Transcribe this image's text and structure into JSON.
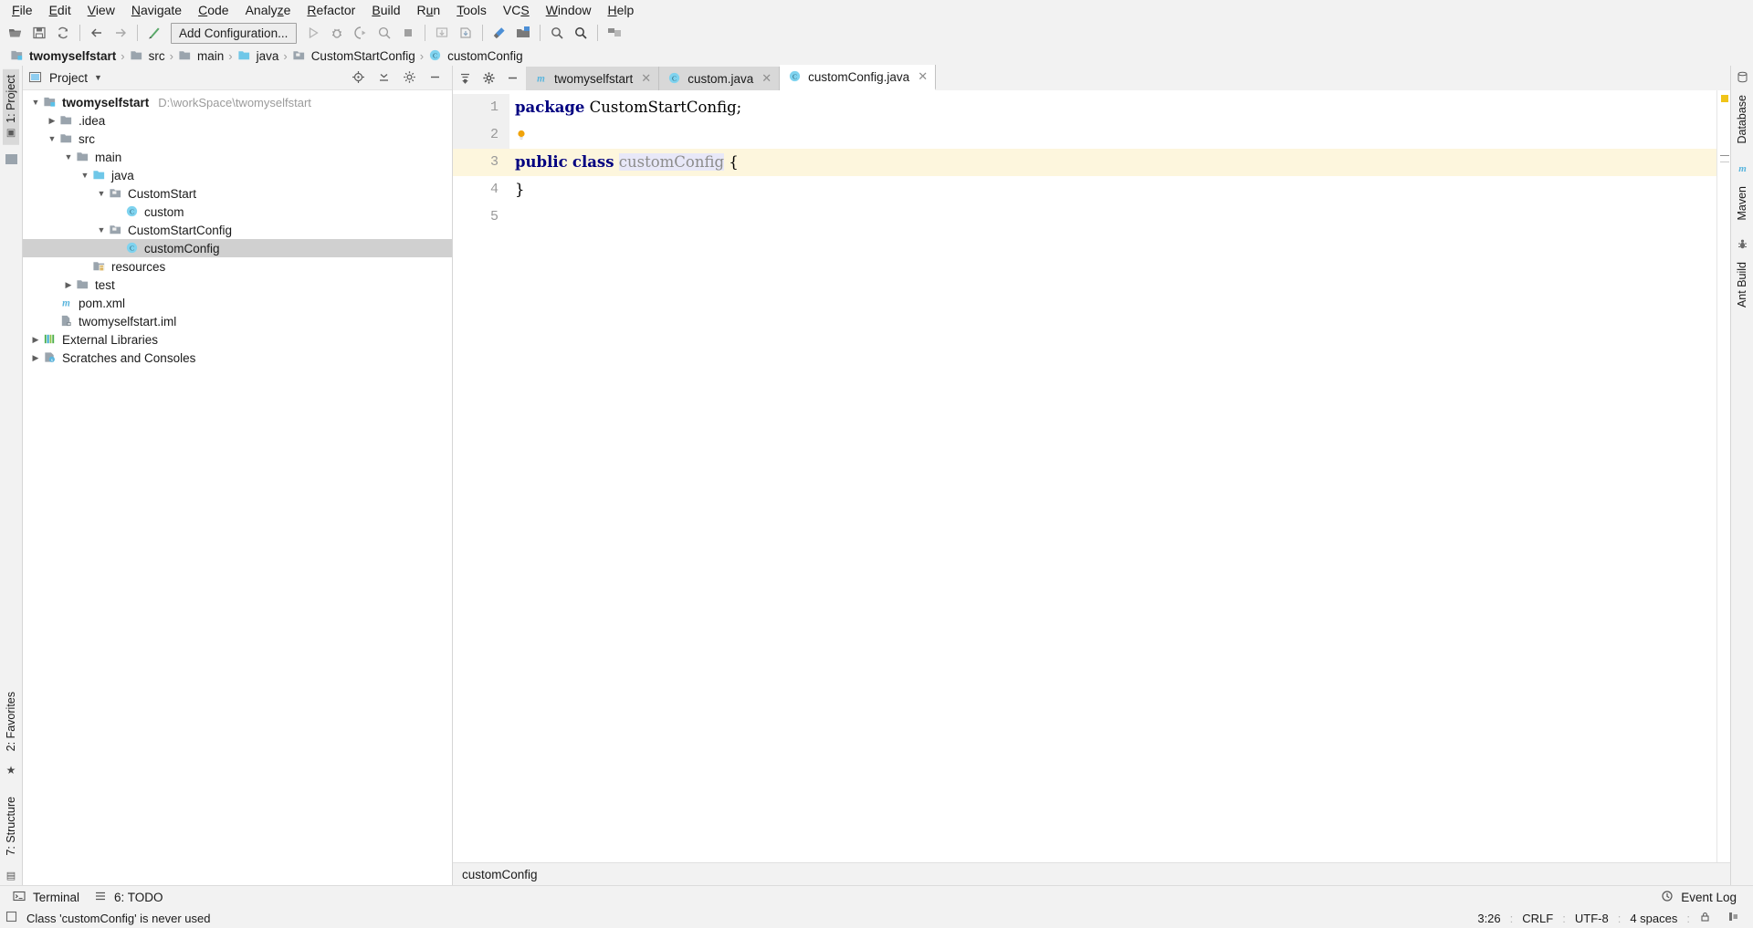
{
  "menubar": {
    "items": [
      {
        "label": "File",
        "accel": "F"
      },
      {
        "label": "Edit",
        "accel": "E"
      },
      {
        "label": "View",
        "accel": "V"
      },
      {
        "label": "Navigate",
        "accel": "N"
      },
      {
        "label": "Code",
        "accel": "C"
      },
      {
        "label": "Analyze",
        "accel": "z"
      },
      {
        "label": "Refactor",
        "accel": "R"
      },
      {
        "label": "Build",
        "accel": "B"
      },
      {
        "label": "Run",
        "accel": "u"
      },
      {
        "label": "Tools",
        "accel": "T"
      },
      {
        "label": "VCS",
        "accel": "S"
      },
      {
        "label": "Window",
        "accel": "W"
      },
      {
        "label": "Help",
        "accel": "H"
      }
    ]
  },
  "toolbar": {
    "run_configuration": "Add Configuration...",
    "buttons": [
      "open-icon",
      "save-all-icon",
      "sync-icon",
      "back-icon",
      "forward-icon",
      "build-icon",
      "run-icon",
      "debug-icon",
      "run-coverage-icon",
      "profile-icon",
      "stop-icon",
      "update-project-icon",
      "commit-icon",
      "settings-icon",
      "project-structure-icon",
      "search-everywhere-icon",
      "search-icon",
      "layout-icon"
    ]
  },
  "breadcrumb": {
    "items": [
      {
        "label": "twomyselfstart",
        "icon": "module-icon",
        "bold": true
      },
      {
        "label": "src",
        "icon": "folder-icon",
        "bold": false
      },
      {
        "label": "main",
        "icon": "folder-icon",
        "bold": false
      },
      {
        "label": "java",
        "icon": "source-root-icon",
        "bold": false
      },
      {
        "label": "CustomStartConfig",
        "icon": "package-icon",
        "bold": false
      },
      {
        "label": "customConfig",
        "icon": "class-icon",
        "bold": false
      }
    ]
  },
  "left_rail": {
    "top": [
      {
        "label": "1: Project",
        "icon": "project-icon",
        "selected": true
      }
    ],
    "bottom": [
      {
        "label": "2: Favorites",
        "icon": "star-icon",
        "selected": false
      },
      {
        "label": "7: Structure",
        "icon": "structure-icon",
        "selected": false
      }
    ]
  },
  "right_rail": {
    "items": [
      "Database",
      "Maven",
      "Ant Build"
    ]
  },
  "project_panel": {
    "title": "Project",
    "title_icon": "project-view-icon",
    "dropdown_icon": "chevron-down-icon",
    "actions": [
      "locate-icon",
      "collapse-all-icon",
      "settings-icon",
      "hide-icon"
    ],
    "tree": [
      {
        "depth": 0,
        "arrow": "down",
        "icon": "module-icon",
        "label": "twomyselfstart",
        "bold": true,
        "path": "D:\\workSpace\\twomyselfstart",
        "selected": false
      },
      {
        "depth": 1,
        "arrow": "right",
        "icon": "folder-icon",
        "label": ".idea",
        "bold": false,
        "path": "",
        "selected": false
      },
      {
        "depth": 1,
        "arrow": "down",
        "icon": "folder-icon",
        "label": "src",
        "bold": false,
        "path": "",
        "selected": false
      },
      {
        "depth": 2,
        "arrow": "down",
        "icon": "folder-icon",
        "label": "main",
        "bold": false,
        "path": "",
        "selected": false
      },
      {
        "depth": 3,
        "arrow": "down",
        "icon": "source-root-icon",
        "label": "java",
        "bold": false,
        "path": "",
        "selected": false
      },
      {
        "depth": 4,
        "arrow": "down",
        "icon": "package-icon",
        "label": "CustomStart",
        "bold": false,
        "path": "",
        "selected": false
      },
      {
        "depth": 5,
        "arrow": "none",
        "icon": "class-icon",
        "label": "custom",
        "bold": false,
        "path": "",
        "selected": false
      },
      {
        "depth": 4,
        "arrow": "down",
        "icon": "package-icon",
        "label": "CustomStartConfig",
        "bold": false,
        "path": "",
        "selected": false
      },
      {
        "depth": 5,
        "arrow": "none",
        "icon": "class-icon",
        "label": "customConfig",
        "bold": false,
        "path": "",
        "selected": true
      },
      {
        "depth": 3,
        "arrow": "none",
        "icon": "resource-root-icon",
        "label": "resources",
        "bold": false,
        "path": "",
        "selected": false
      },
      {
        "depth": 2,
        "arrow": "right",
        "icon": "folder-icon",
        "label": "test",
        "bold": false,
        "path": "",
        "selected": false
      },
      {
        "depth": 1,
        "arrow": "none",
        "icon": "maven-icon",
        "label": "pom.xml",
        "bold": false,
        "path": "",
        "selected": false
      },
      {
        "depth": 1,
        "arrow": "none",
        "icon": "iml-icon",
        "label": "twomyselfstart.iml",
        "bold": false,
        "path": "",
        "selected": false
      },
      {
        "depth": 0,
        "arrow": "right",
        "icon": "libraries-icon",
        "label": "External Libraries",
        "bold": false,
        "path": "",
        "selected": false
      },
      {
        "depth": 0,
        "arrow": "right",
        "icon": "scratches-icon",
        "label": "Scratches and Consoles",
        "bold": false,
        "path": "",
        "selected": false
      }
    ]
  },
  "editor": {
    "tab_tools": [
      "sort-icon",
      "settings-gear-icon",
      "hide-icon"
    ],
    "tabs": [
      {
        "label": "twomyselfstart",
        "icon": "maven-icon",
        "active": false,
        "closable": true
      },
      {
        "label": "custom.java",
        "icon": "class-icon",
        "active": false,
        "closable": true
      },
      {
        "label": "customConfig.java",
        "icon": "class-icon",
        "active": true,
        "closable": true
      }
    ],
    "line_numbers": [
      "1",
      "2",
      "3",
      "4",
      "5"
    ],
    "code_lines": [
      {
        "n": 1,
        "highlight": false,
        "tokens": [
          {
            "t": "package",
            "c": "kw"
          },
          {
            "t": " CustomStartConfig;",
            "c": "ident"
          }
        ]
      },
      {
        "n": 2,
        "highlight": false,
        "gutter_icon": "intention-bulb-icon",
        "tokens": []
      },
      {
        "n": 3,
        "highlight": true,
        "tokens": [
          {
            "t": "public",
            "c": "kw"
          },
          {
            "t": " ",
            "c": "ident"
          },
          {
            "t": "class",
            "c": "kw"
          },
          {
            "t": " ",
            "c": "ident"
          },
          {
            "t": "customConfig",
            "c": "cname"
          },
          {
            "t": " {",
            "c": "ident"
          }
        ]
      },
      {
        "n": 4,
        "highlight": false,
        "tokens": [
          {
            "t": "}",
            "c": "ident"
          }
        ]
      },
      {
        "n": 5,
        "highlight": false,
        "tokens": []
      }
    ],
    "bottom_breadcrumb": "customConfig"
  },
  "bottom_bar": {
    "items": [
      {
        "label": "Terminal",
        "icon": "terminal-icon"
      },
      {
        "label": "6: TODO",
        "icon": "todo-icon"
      }
    ],
    "right": [
      {
        "label": "Event Log",
        "icon": "event-log-icon"
      }
    ]
  },
  "statusbar": {
    "message": "Class 'customConfig' is never used",
    "message_icon": "inspection-icon",
    "caret": "3:26",
    "line_separator": "CRLF",
    "encoding": "UTF-8",
    "indent": "4 spaces",
    "lock_icon": "lock-icon",
    "branch_icon": "git-branch-icon"
  },
  "colors": {
    "chrome": "#f2f2f2",
    "panel": "#ffffff",
    "selection": "#d0d0d0",
    "line_highlight": "#fdf6dd",
    "keyword": "#000080",
    "source_root": "#6fc7e8",
    "accent_green": "#59a869",
    "warn": "#f0c419"
  }
}
